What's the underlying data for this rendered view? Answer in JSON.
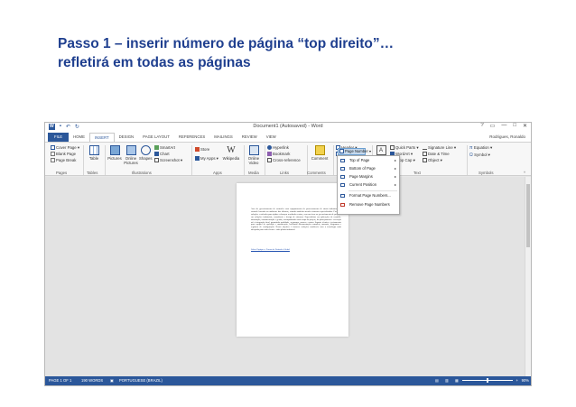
{
  "slide": {
    "title_line1": "Passo 1 – inserir número de página “top direito”…",
    "title_line2": "refletirá em todas as páginas"
  },
  "window": {
    "title": "Document1 (Autosaved) - Word",
    "user": "Rodrigues, Ronaldo",
    "controls": [
      "?",
      "▭",
      "—",
      "□",
      "✕"
    ]
  },
  "tabs": [
    "FILE",
    "HOME",
    "INSERT",
    "DESIGN",
    "PAGE LAYOUT",
    "REFERENCES",
    "MAILINGS",
    "REVIEW",
    "VIEW"
  ],
  "active_tab": "INSERT",
  "ribbon": {
    "pages": {
      "cover": "Cover Page ▾",
      "blank": "Blank Page",
      "break": "Page Break",
      "group": "Pages"
    },
    "tables": {
      "table": "Table",
      "group": "Tables"
    },
    "illustrations": {
      "pictures": "Pictures",
      "online": "Online Pictures",
      "shapes": "Shapes",
      "smartart": "SmartArt",
      "chart": "Chart",
      "screenshot": "Screenshot ▾",
      "group": "Illustrations"
    },
    "apps": {
      "store": "Store",
      "myapps": "My Apps ▾",
      "wikipedia": "Wikipedia",
      "group": "Apps"
    },
    "media": {
      "video": "Online Video",
      "group": "Media"
    },
    "links": {
      "hyperlink": "Hyperlink",
      "bookmark": "Bookmark",
      "crossref": "Cross-reference",
      "group": "Links"
    },
    "comments": {
      "comment": "Comment",
      "group": "Comments"
    },
    "header_footer": {
      "header": "Header ▾",
      "footer": "Footer ▾",
      "pagenumber": "Page Number ▾",
      "group": "Header & Footer"
    },
    "text": {
      "textbox": "Text Box ▾",
      "quickparts": "Quick Parts ▾",
      "wordart": "WordArt ▾",
      "dropcap": "Drop Cap ▾",
      "signature": "Signature Line ▾",
      "datetime": "Date & Time",
      "object": "Object ▾",
      "group": "Text"
    },
    "symbols": {
      "equation": "Equation ▾",
      "symbol": "Symbol ▾",
      "group": "Symbols"
    }
  },
  "dropdown": [
    {
      "label": "Top of Page",
      "sub": true
    },
    {
      "label": "Bottom of Page",
      "sub": true
    },
    {
      "label": "Page Margins",
      "sub": true
    },
    {
      "label": "Current Position",
      "sub": true
    },
    {
      "label": "Format Page Numbers...",
      "sub": false
    },
    {
      "label": "Remove Page Numbers",
      "sub": false
    }
  ],
  "document": {
    "body": "Área de gerenciamento de controles com equipamentos de processamento de sinais industriais de controle baseado no ambiente das fábricas, visando também atender sistemas especializados. Fornecer soluções e métodos para ajudar a alcançar resultados exatos, com um foco no gerenciamento de projetos em soluções industriais, consultoria e design de sistemas. Especialistas em aplicações de controle, automação, instrumentação e gestão, acompanhando cada etapa do projeto, do planejamento e execução até a integração final, garantindo qualidade, segurança, prazos e custos. Suporte técnico e treinamento para equipes de operação e manutenção, incluindo documentação completa, manuais, diagramas e registros de configuração. Nosso objetivo é fornecer soluções confiáveis com a tecnologia mais adequada para cada cliente e cada planta industrial.",
    "link": "Sobre Equipes e Forma de Emissão Global"
  },
  "status": {
    "page": "PAGE 1 OF 1",
    "words": "190 WORDS",
    "language": "PORTUGUESE (BRAZIL)",
    "zoom": "90%"
  },
  "colors": {
    "accent": "#2b579a",
    "title": "#1f3f8f",
    "highlight": "#c5d9ee"
  }
}
